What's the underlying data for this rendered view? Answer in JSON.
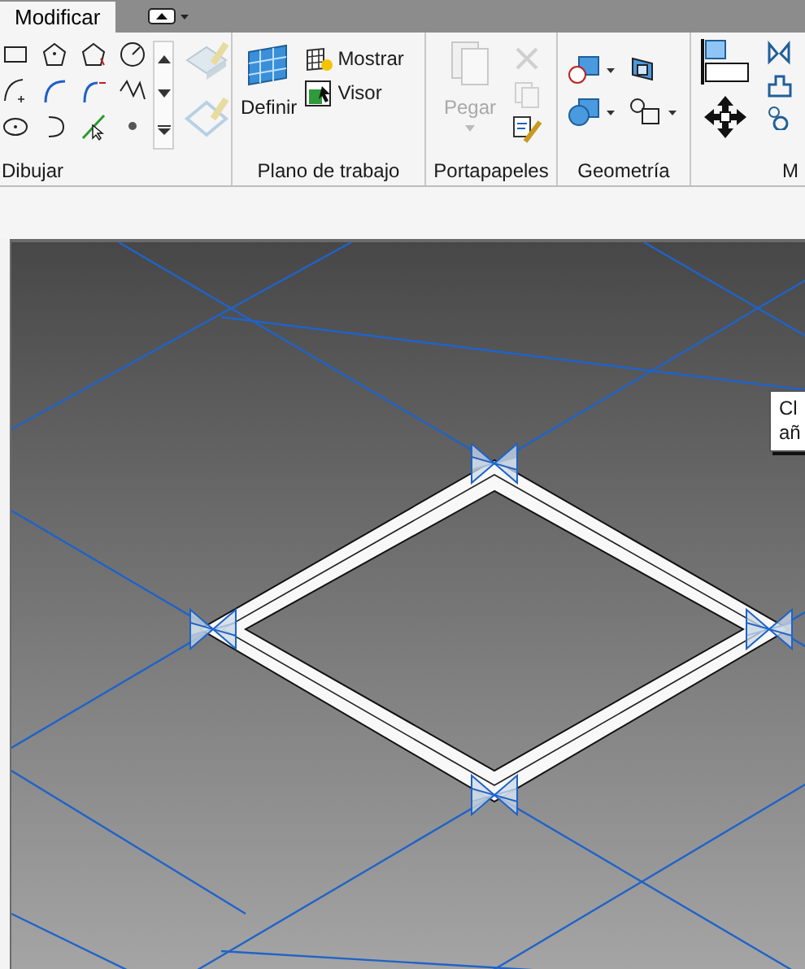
{
  "tabs": [
    {
      "label": "Modificar",
      "selected": true
    }
  ],
  "panels": [
    {
      "label": "Dibujar"
    },
    {
      "label": "Plano de trabajo",
      "buttons": [
        {
          "label": "Definir"
        },
        {
          "label": "Mostrar"
        },
        {
          "label": "Visor"
        }
      ]
    },
    {
      "label": "Portapapeles",
      "buttons": [
        {
          "label": "Pegar",
          "disabled": true
        }
      ]
    },
    {
      "label": "Geometría"
    },
    {
      "label": "M"
    }
  ],
  "tooltip": {
    "lines": [
      "Cl",
      "añ"
    ]
  }
}
